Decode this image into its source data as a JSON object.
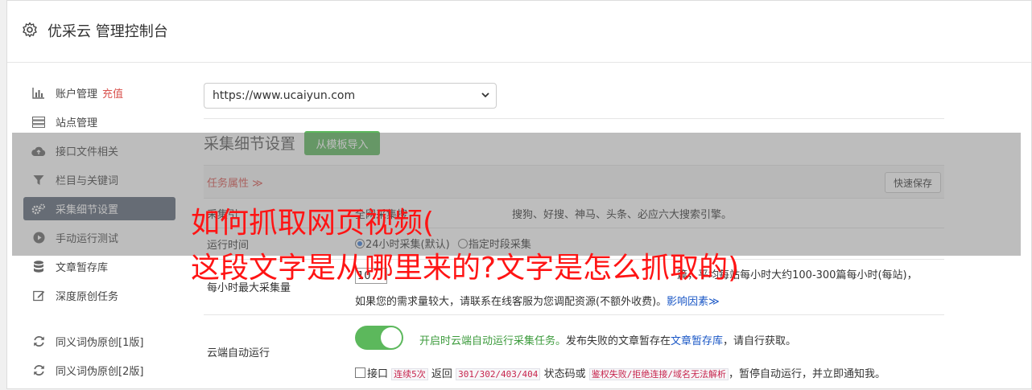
{
  "header": {
    "title": "优采云 管理控制台",
    "icon": "gear-icon"
  },
  "sidebar": {
    "items": [
      {
        "label": "账户管理",
        "extra": "充值",
        "icon": "bar-chart-icon"
      },
      {
        "label": "站点管理",
        "icon": "server-icon"
      },
      {
        "label": "接口文件相关",
        "icon": "cloud-upload-icon"
      },
      {
        "label": "栏目与关键词",
        "icon": "filter-icon"
      },
      {
        "label": "采集细节设置",
        "icon": "cogs-icon",
        "active": true
      },
      {
        "label": "手动运行测试",
        "icon": "play-circle-icon"
      },
      {
        "label": "文章暂存库",
        "icon": "database-icon"
      },
      {
        "label": "深度原创任务",
        "icon": "edit-icon"
      },
      {
        "label": "同义词伪原创[1版]",
        "icon": "refresh-icon"
      },
      {
        "label": "同义词伪原创[2版]",
        "icon": "refresh-icon"
      }
    ]
  },
  "site_select": {
    "value": "https://www.ucaiyun.com"
  },
  "section": {
    "title": "采集细节设置",
    "import_button": "从模板导入"
  },
  "table": {
    "task_attr": "任务属性 ≫",
    "quick_save": "快速保存",
    "row1": {
      "label": "采集引",
      "value": "全网采集搜",
      "value_tail": "搜狗、好搜、神马、头条、必应六大搜索引擎。"
    },
    "run_time": {
      "label": "运行时间",
      "option1": "24小时采集(默认)",
      "option2": "指定时段采集"
    },
    "max_per_hour": {
      "label": "每小时最大采集量",
      "input_value": "10",
      "line1": "篇，平均每站每小时大约100-300篇每小时(每站)，",
      "line2": "如果您的需求量较大，请联系在线客服为您调配资源(不额外收费)。",
      "link": "影响因素≫"
    },
    "cloud_run": {
      "label": "云端自动运行",
      "toggle_on": true,
      "desc_green": "开启时云端自动运行采集任务。",
      "desc_mid": "发布失败的文章暂存在",
      "desc_link": "文章暂存库",
      "desc_end": "，请自行获取。",
      "cb_label": "接口",
      "code1": "连续5次",
      "t1": "返回",
      "code2": "301/302/403/404",
      "t2": "状态码或",
      "code3": "鉴权失败/拒绝连接/域名无法解析",
      "t3": "，暂停自动运行，并立即通知我。"
    }
  },
  "overlay": {
    "line1": "如何抓取网页视频(",
    "line2": "这段文字是从哪里来的?文字是怎么抓取的)"
  },
  "colors": {
    "accent_green": "#5cb85c",
    "active_sidebar": "#5b6777",
    "danger_red": "#d9534f",
    "link_blue": "#1a57c6",
    "overlay_text": "#ff1414"
  }
}
